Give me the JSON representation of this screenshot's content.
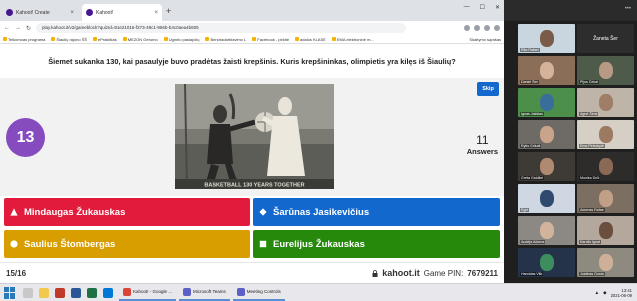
{
  "browser": {
    "tabs": [
      {
        "label": "Kahoot! Create",
        "close": "×"
      },
      {
        "label": "Kahoot!",
        "close": "×"
      }
    ],
    "new_tab": "+",
    "url": "play.kahoot.it/v2/gameblock?quizId=91e21016-f273-49c1-956b-b4c0aea4b605",
    "bookmarks": [
      "Telkomoas programa",
      "Šiaulių rajono ŠŠ",
      "ePraktikas",
      "MEZON Gerumo",
      "Ugnelo paslapčių",
      "Bendradarbiavimo L",
      "Facebook - pirkite",
      "adalos KLASE",
      "EMA elektroninė m..."
    ],
    "bookmarks_right": "Skaitymo sąrašas"
  },
  "kahoot": {
    "question": "Šiemet sukanka 130, kai pasaulyje buvo pradėtas žaisti krepšinis. Kuris krepšininkas, olimpietis yra kilęs iš Šiaulių?",
    "image_caption": "BASKETBALL 130 YEARS TOGETHER",
    "timer": "13",
    "skip_label": "Skip",
    "answers_count": "11",
    "answers_label": "Answers",
    "answers": [
      {
        "text": "Mindaugas Žukauskas",
        "shape": "triangle",
        "color": "#e21b3c"
      },
      {
        "text": "Šarūnas Jasikevičius",
        "shape": "diamond",
        "color": "#1368ce"
      },
      {
        "text": "Saulius Štombergas",
        "shape": "circle",
        "color": "#d89e00"
      },
      {
        "text": "Eurelijus Žukauskas",
        "shape": "square",
        "color": "#26890c"
      }
    ],
    "progress": "15/16",
    "brand": "kahoot.it",
    "pin_label": "Game PIN:",
    "pin": "7679211"
  },
  "teams": {
    "participants": [
      "Rita Rafael",
      "Žaneta Šer",
      "Daniel Šer",
      "Pijus Čekai",
      "Ignas Jakštas",
      "Agnė Šimk",
      "Rytis Grikalt",
      "Ema Peleckytė",
      "Greta Galdikė",
      "Monika Drūt",
      "Eglė",
      "Adomas Rafae",
      "Audėja Adoma",
      "Karolis Ignat",
      "Haroldas Vitk",
      "Justinas Gusta"
    ]
  },
  "taskbar": {
    "apps": [
      {
        "label": "Kahoot! - Google ...",
        "color": "#db4437"
      },
      {
        "label": "Microsoft Teams",
        "color": "#5b5fc7"
      },
      {
        "label": "Meeting Controls",
        "color": "#5b5fc7"
      }
    ],
    "time": "13:41",
    "date": "2021-06-09"
  },
  "colors": {
    "purple": "#864cbf",
    "skip_blue": "#1368ce"
  }
}
